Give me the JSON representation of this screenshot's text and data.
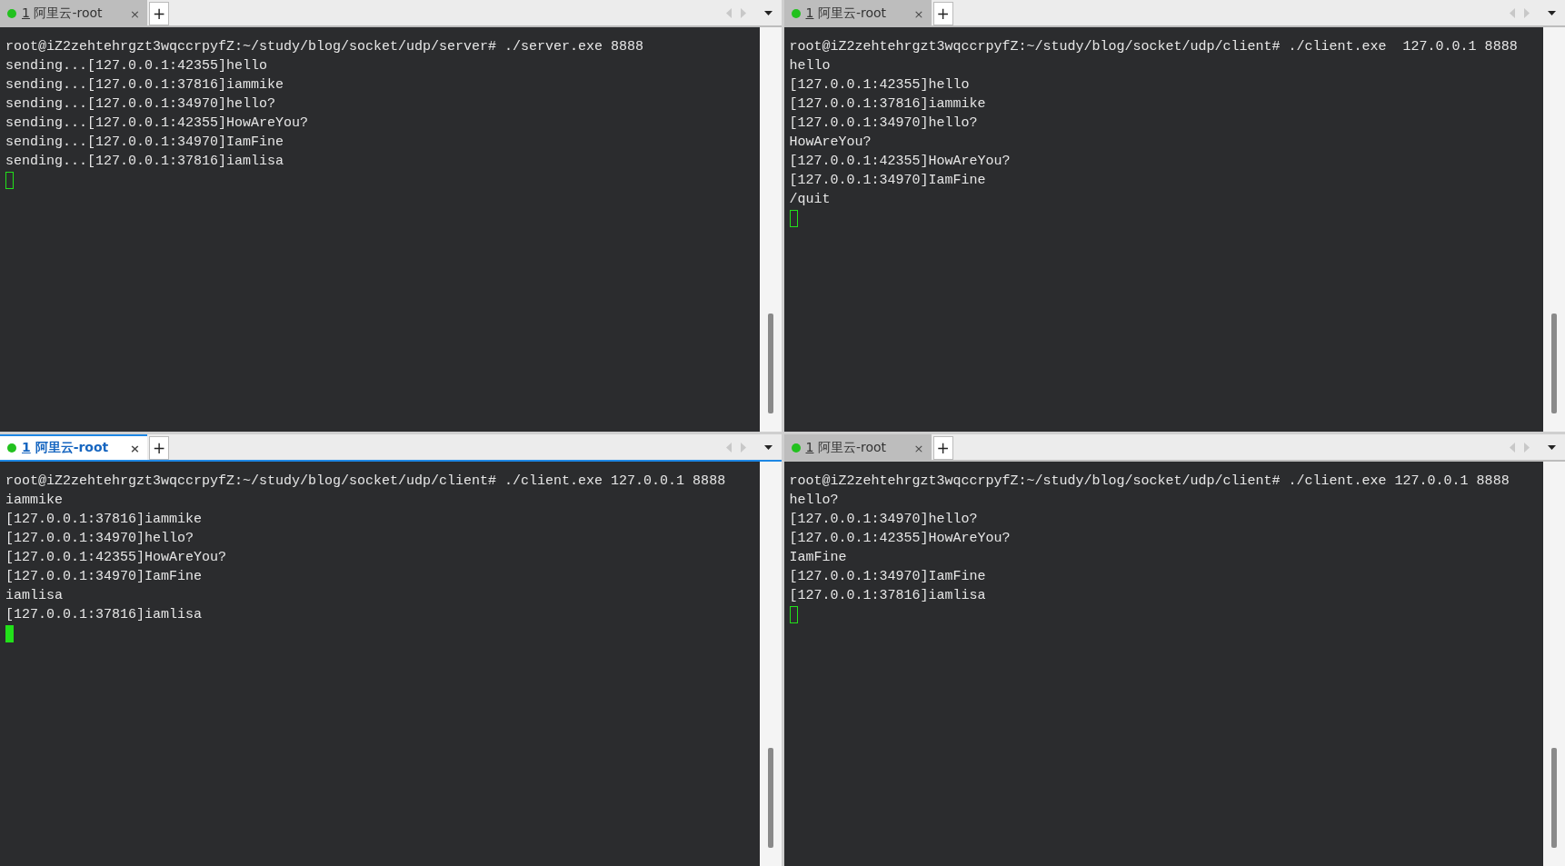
{
  "panes": [
    {
      "tab": {
        "number": "1",
        "title": "阿里云-root",
        "selected": false
      },
      "close": "×",
      "add": "+",
      "focused": false,
      "lines": [
        "root@iZ2zehtehrgzt3wqccrpyfZ:~/study/blog/socket/udp/server# ./server.exe 8888",
        "sending...[127.0.0.1:42355]hello",
        "sending...[127.0.0.1:37816]iammike",
        "sending...[127.0.0.1:34970]hello?",
        "sending...[127.0.0.1:42355]HowAreYou?",
        "sending...[127.0.0.1:34970]IamFine",
        "sending...[127.0.0.1:37816]iamlisa"
      ]
    },
    {
      "tab": {
        "number": "1",
        "title": "阿里云-root",
        "selected": false
      },
      "close": "×",
      "add": "+",
      "focused": false,
      "lines": [
        "root@iZ2zehtehrgzt3wqccrpyfZ:~/study/blog/socket/udp/client# ./client.exe  127.0.0.1 8888",
        "hello",
        "[127.0.0.1:42355]hello",
        "[127.0.0.1:37816]iammike",
        "[127.0.0.1:34970]hello?",
        "HowAreYou?",
        "[127.0.0.1:42355]HowAreYou?",
        "[127.0.0.1:34970]IamFine",
        "/quit"
      ]
    },
    {
      "tab": {
        "number": "1",
        "title": "阿里云-root",
        "selected": true
      },
      "close": "×",
      "add": "+",
      "focused": true,
      "lines": [
        "root@iZ2zehtehrgzt3wqccrpyfZ:~/study/blog/socket/udp/client# ./client.exe 127.0.0.1 8888",
        "iammike",
        "[127.0.0.1:37816]iammike",
        "[127.0.0.1:34970]hello?",
        "[127.0.0.1:42355]HowAreYou?",
        "[127.0.0.1:34970]IamFine",
        "iamlisa",
        "[127.0.0.1:37816]iamlisa"
      ]
    },
    {
      "tab": {
        "number": "1",
        "title": "阿里云-root",
        "selected": false
      },
      "close": "×",
      "add": "+",
      "focused": false,
      "lines": [
        "root@iZ2zehtehrgzt3wqccrpyfZ:~/study/blog/socket/udp/client# ./client.exe 127.0.0.1 8888",
        "hello?",
        "[127.0.0.1:34970]hello?",
        "[127.0.0.1:42355]HowAreYou?",
        "IamFine",
        "[127.0.0.1:34970]IamFine",
        "[127.0.0.1:37816]iamlisa"
      ]
    }
  ]
}
